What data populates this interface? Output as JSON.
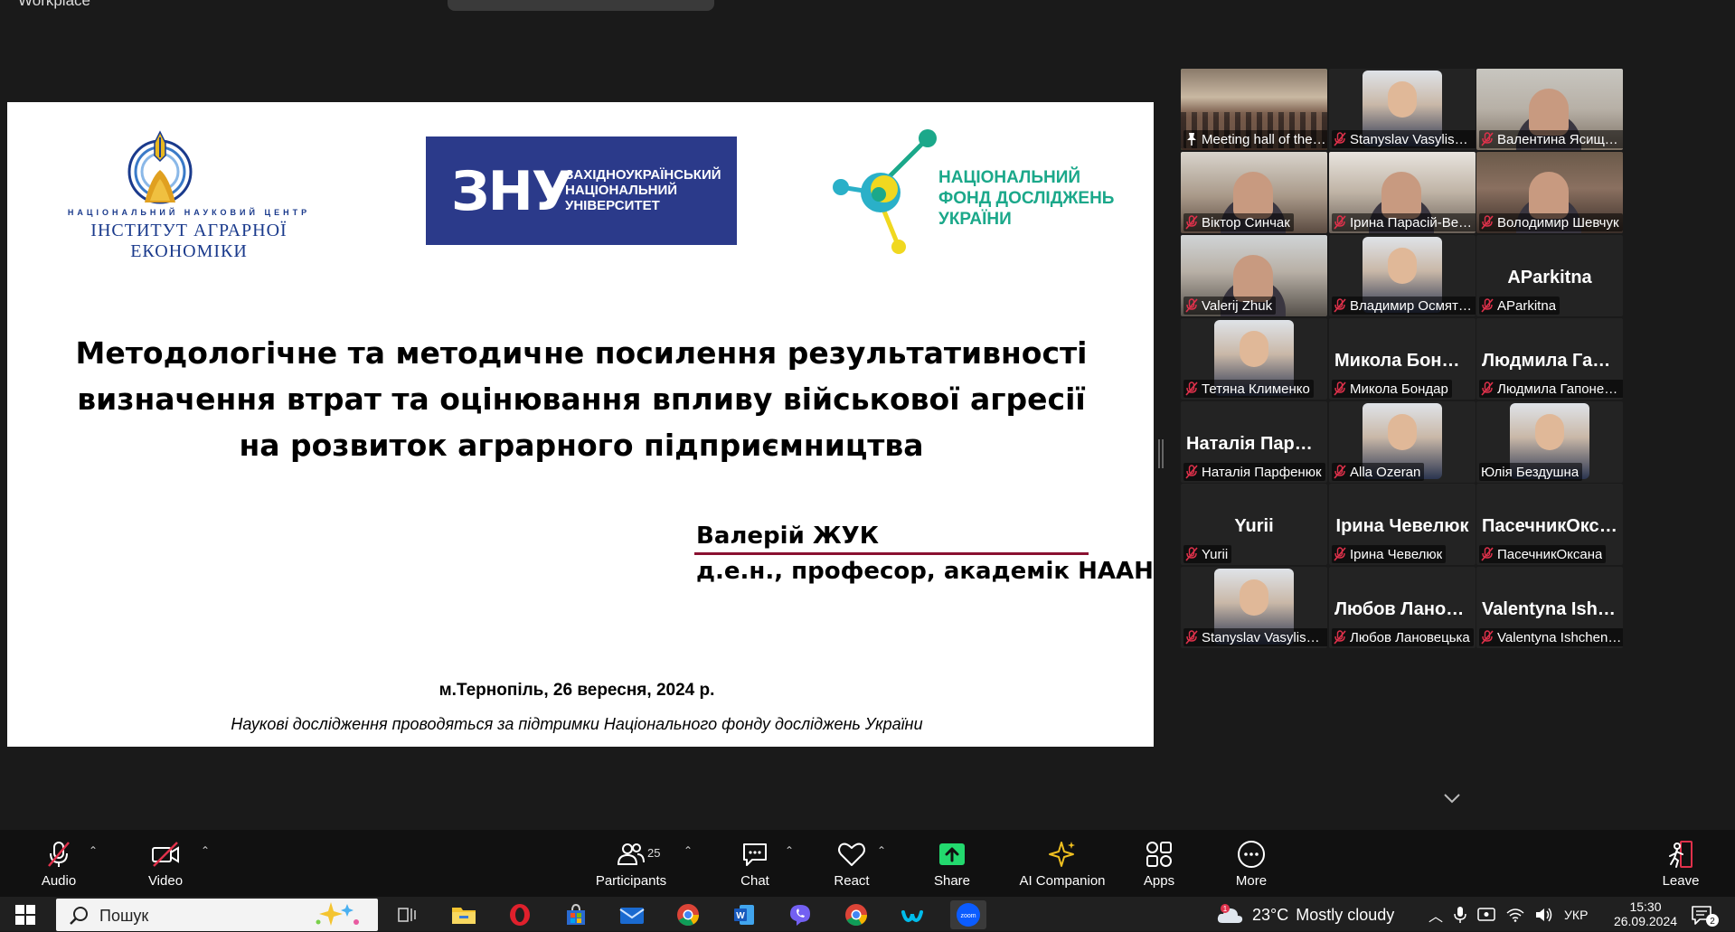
{
  "window": {
    "title": "Workplace"
  },
  "slide": {
    "logo1_line1": "НАЦІОНАЛЬНИЙ НАУКОВИЙ ЦЕНТР",
    "logo1_line2": "ІНСТИТУТ АГРАРНОЇ ЕКОНОМІКИ",
    "logo2_mark": "ЗНУ",
    "logo2_line1": "ЗАХІДНОУКРАЇНСЬКИЙ",
    "logo2_line2": "НАЦІОНАЛЬНИЙ",
    "logo2_line3": "УНІВЕРСИТЕТ",
    "logo3_line1": "НАЦІОНАЛЬНИЙ",
    "logo3_line2": "ФОНД ДОСЛІДЖЕНЬ",
    "logo3_line3": "УКРАЇНИ",
    "title_line1": "Методологічне та методичне посилення результативності",
    "title_line2": "визначення втрат та оцінювання впливу військової агресії",
    "title_line3": "на розвиток аграрного підприємництва",
    "author_name": "Валерій ЖУК",
    "author_title": "д.е.н., професор, академік НААН",
    "date": "м.Тернопіль, 26 вересня, 2024 р.",
    "footer": "Наукові дослідження проводяться за підтримки Національного фонду досліджень України"
  },
  "gallery": {
    "tiles": [
      {
        "label": "Meeting hall of the aca...",
        "kind": "room",
        "active": true,
        "muted": false,
        "pinned": true
      },
      {
        "label": "Stanyslav Vasylishyn",
        "kind": "avatar",
        "muted": true
      },
      {
        "label": "Валентина Ясищена",
        "kind": "video",
        "muted": true
      },
      {
        "label": "Віктор Синчак",
        "kind": "video",
        "muted": true
      },
      {
        "label": "Ірина Парасій-Вергун...",
        "kind": "video",
        "muted": true
      },
      {
        "label": "Володимир Шевчук",
        "kind": "video",
        "muted": true
      },
      {
        "label": "Valerij Zhuk",
        "kind": "video",
        "muted": true
      },
      {
        "label": "Владимир Осмятченко",
        "kind": "avatar",
        "muted": true
      },
      {
        "label": "AParkitna",
        "big": "AParkitna",
        "kind": "name",
        "muted": true
      },
      {
        "label": "Тетяна Клименко",
        "kind": "avatar",
        "muted": true
      },
      {
        "label": "Микола Бондар",
        "big": "Микола Бондар",
        "kind": "name",
        "muted": true
      },
      {
        "label": "Людмила Гапоненко",
        "big": "Людмила Гапо...",
        "kind": "name",
        "muted": true
      },
      {
        "label": "Наталія Парфенюк",
        "big": "Наталія Парфе...",
        "kind": "name",
        "muted": true
      },
      {
        "label": "Alla Ozeran",
        "kind": "avatar",
        "muted": true
      },
      {
        "label": "Юлія Бездушна",
        "kind": "avatar",
        "muted": false
      },
      {
        "label": "Yurii",
        "big": "Yurii",
        "kind": "name",
        "muted": true
      },
      {
        "label": "Ірина Чевелюк",
        "big": "Ірина Чевелюк",
        "kind": "name",
        "muted": true
      },
      {
        "label": "ПасечникОксана",
        "big": "ПасечникОксана",
        "kind": "name",
        "muted": true
      },
      {
        "label": "Stanyslav Vasylishyn",
        "kind": "avatar",
        "muted": true
      },
      {
        "label": "Любов Лановецька",
        "big": "Любов Ланове...",
        "kind": "name",
        "muted": true
      },
      {
        "label": "Valentyna Ishchenko",
        "big": "Valentyna Ishch...",
        "kind": "name",
        "muted": true
      }
    ]
  },
  "toolbar": {
    "audio": "Audio",
    "video": "Video",
    "participants": "Participants",
    "participants_count": "25",
    "chat": "Chat",
    "react": "React",
    "share": "Share",
    "ai": "AI Companion",
    "apps": "Apps",
    "more": "More",
    "leave": "Leave"
  },
  "taskbar": {
    "search_placeholder": "Пошук",
    "weather_temp": "23°C",
    "weather_desc": "Mostly cloudy",
    "weather_badge": "1",
    "lang": "УКР",
    "time": "15:30",
    "date": "26.09.2024",
    "notif_count": "2"
  },
  "colors": {
    "active_speaker": "#23d96e",
    "share_green": "#23d96e",
    "muted_red": "#e0314b",
    "slide_logo_blue": "#2b3a8a",
    "slide_logo_teal": "#1ba88a"
  }
}
